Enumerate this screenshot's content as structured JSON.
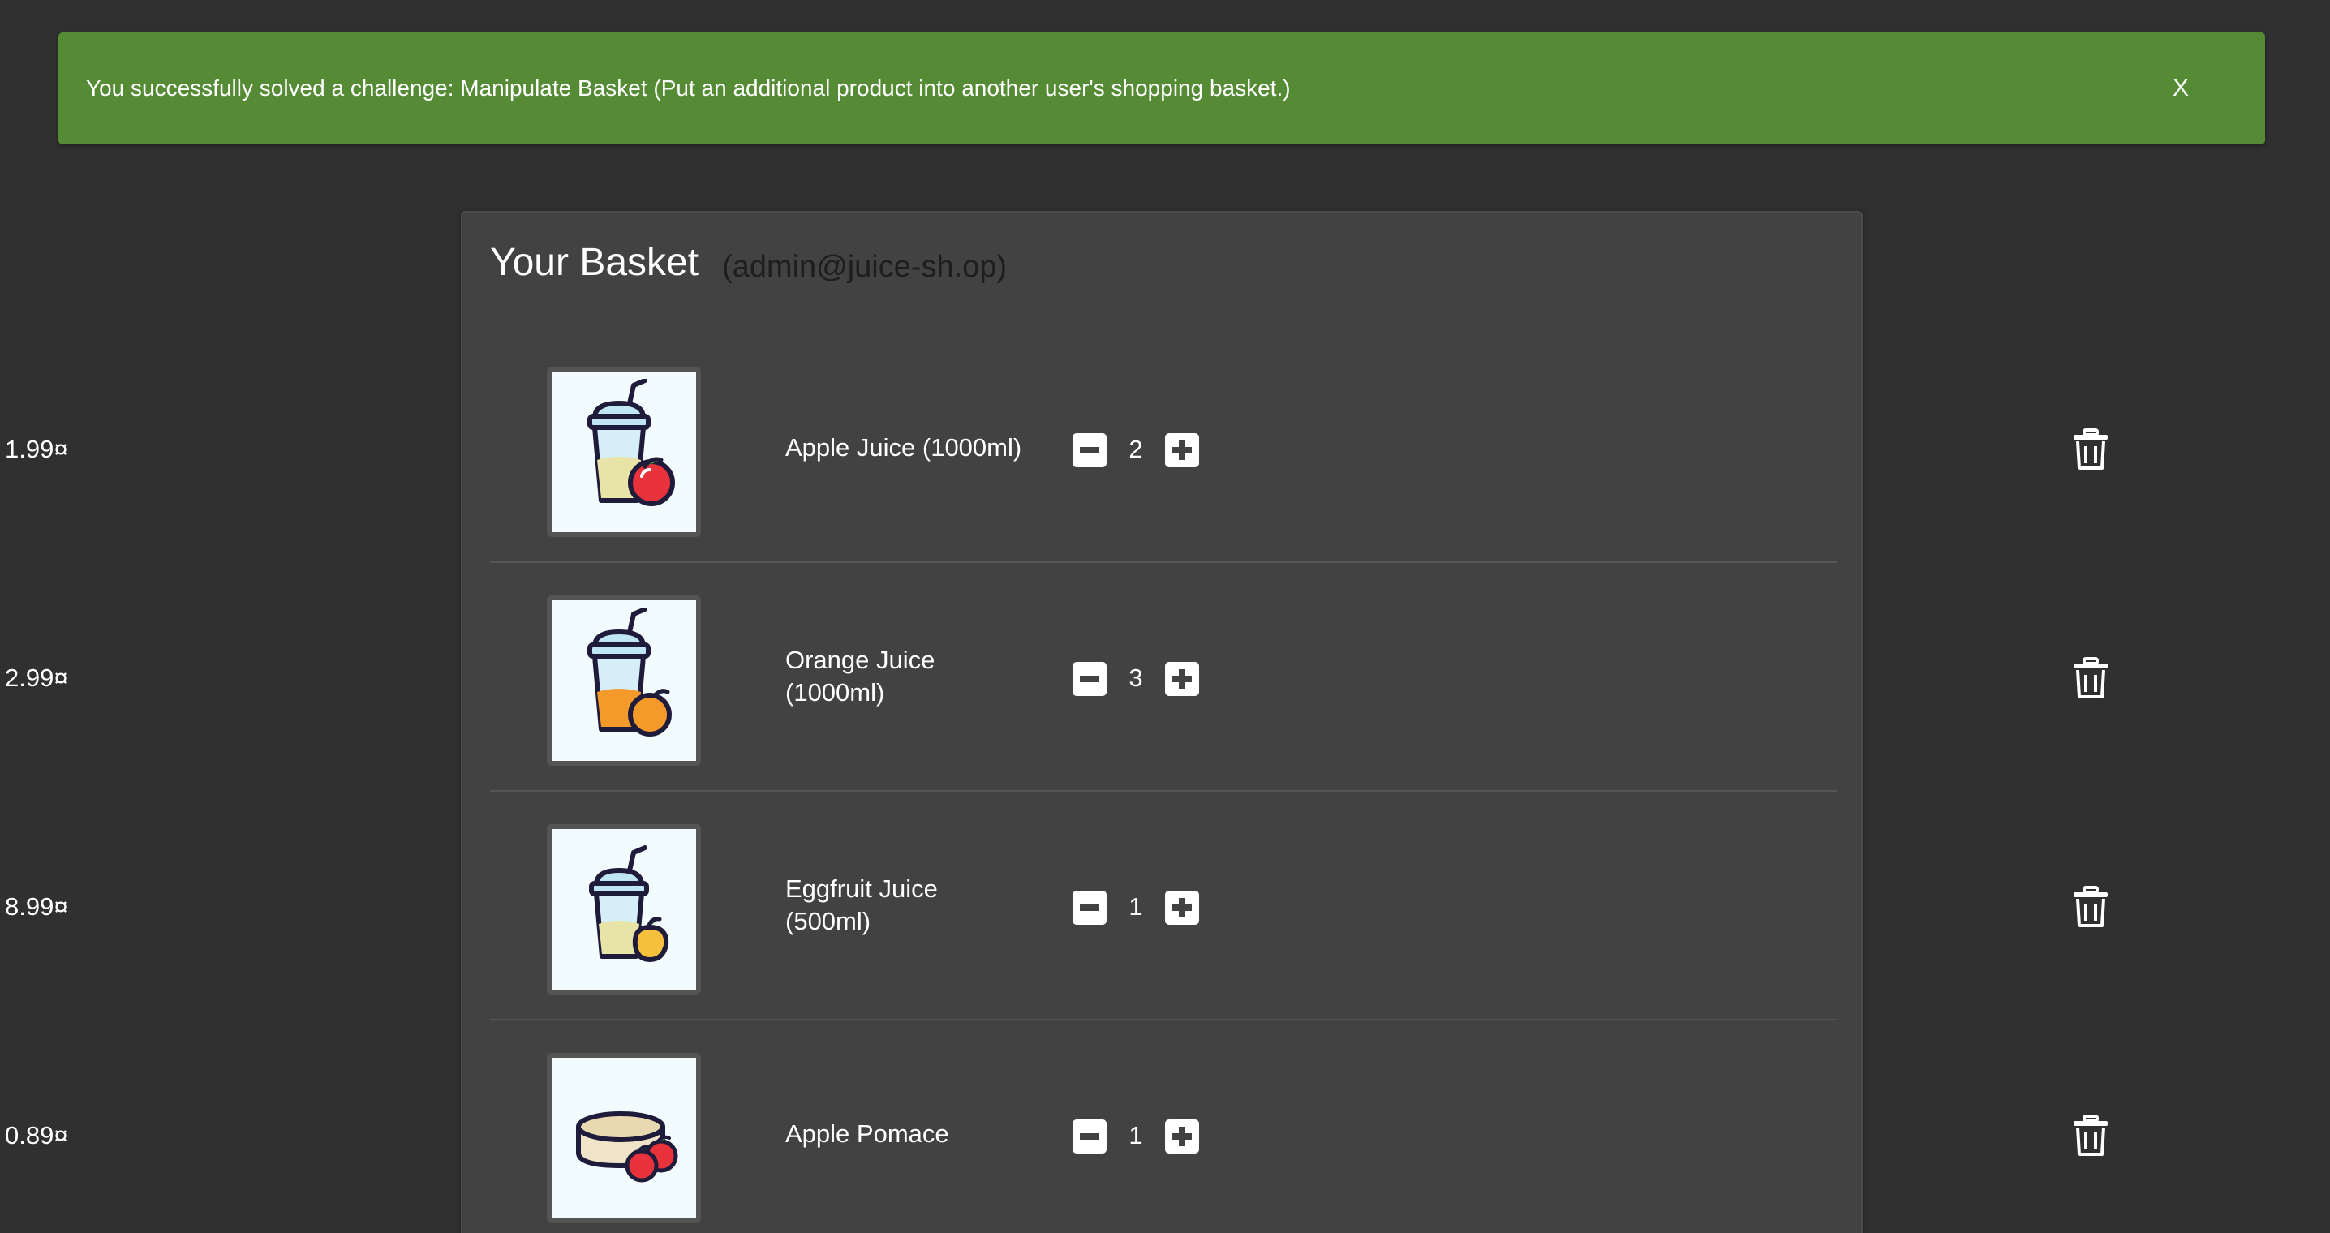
{
  "notification": {
    "message": "You successfully solved a challenge: Manipulate Basket (Put an additional product into another user's shopping basket.)",
    "close_label": "X",
    "color": "#558b35"
  },
  "basket": {
    "title": "Your Basket",
    "user": "(admin@juice-sh.op)",
    "items": [
      {
        "name": "Apple Juice (1000ml)",
        "quantity": "2",
        "price": "1.99¤",
        "image_icon": "apple-juice-icon"
      },
      {
        "name": "Orange Juice (1000ml)",
        "quantity": "3",
        "price": "2.99¤",
        "image_icon": "orange-juice-icon"
      },
      {
        "name": "Eggfruit Juice (500ml)",
        "quantity": "1",
        "price": "8.99¤",
        "image_icon": "eggfruit-juice-icon"
      },
      {
        "name": "Apple Pomace",
        "quantity": "1",
        "price": "0.89¤",
        "image_icon": "apple-pomace-icon"
      }
    ]
  },
  "colors": {
    "background": "#303030",
    "card": "#424242",
    "apple": "#e8323c",
    "orange": "#f39a2b",
    "eggfruit": "#f5c13d"
  }
}
